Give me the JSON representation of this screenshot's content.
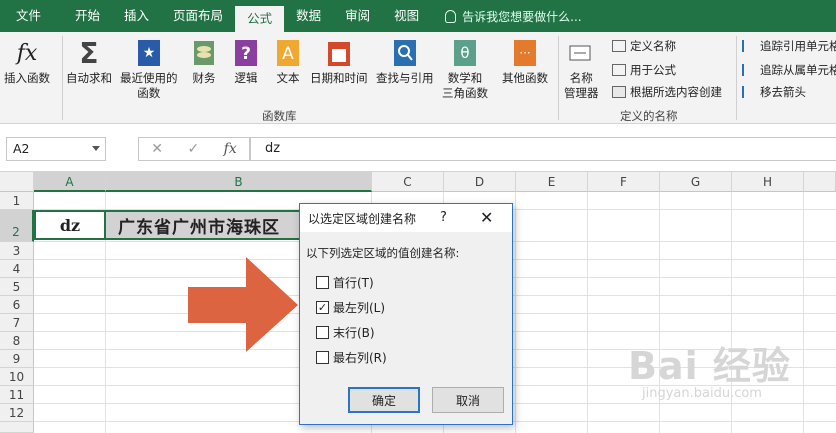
{
  "tabs": [
    "文件",
    "开始",
    "插入",
    "页面布局",
    "公式",
    "数据",
    "审阅",
    "视图"
  ],
  "tell_me": "告诉我您想要做什么...",
  "ribbon": {
    "insert_function": "插入函数",
    "autosum": [
      "自动求和"
    ],
    "recent": [
      "最近使用的",
      "函数"
    ],
    "financial": "财务",
    "logical": "逻辑",
    "text": "文本",
    "datetime": "日期和时间",
    "lookup": "查找与引用",
    "math": [
      "数学和",
      "三角函数"
    ],
    "more": "其他函数",
    "library_label": "函数库",
    "name_manager": [
      "名称",
      "管理器"
    ],
    "define_name": "定义名称",
    "use_in_formula": "用于公式",
    "create_from_selection": "根据所选内容创建",
    "defined_names_label": "定义的名称",
    "trace_precedents": "追踪引用单元格",
    "trace_dependents": "追踪从属单元格",
    "remove_arrows": "移去箭头"
  },
  "formula_bar": {
    "name_box": "A2",
    "fx": "fx",
    "value": "dz"
  },
  "columns": [
    "A",
    "B",
    "C",
    "D",
    "E",
    "F",
    "G",
    "H"
  ],
  "rows": [
    "1",
    "2",
    "3",
    "4",
    "5",
    "6",
    "7",
    "8",
    "9",
    "10",
    "11",
    "12"
  ],
  "cells": {
    "A2": "dz",
    "B2": "广东省广州市海珠区"
  },
  "dialog": {
    "title": "以选定区域创建名称",
    "help": "?",
    "close": "✕",
    "prompt": "以下列选定区域的值创建名称:",
    "options": [
      {
        "label": "首行(T)",
        "checked": false
      },
      {
        "label": "最左列(L)",
        "checked": true
      },
      {
        "label": "末行(B)",
        "checked": false
      },
      {
        "label": "最右列(R)",
        "checked": false
      }
    ],
    "ok": "确定",
    "cancel": "取消"
  },
  "watermark": {
    "brand": "Bai 经验",
    "url": "jingyan.baidu.com"
  },
  "colors": {
    "excel_green": "#217346",
    "arrow": "#dc6440",
    "dialog_border": "#2b74c9"
  }
}
